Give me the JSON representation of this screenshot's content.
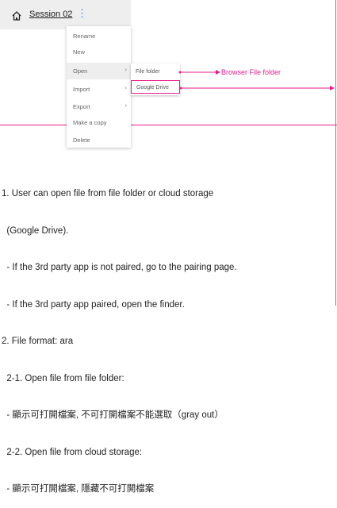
{
  "header": {
    "session_title": "Session 02"
  },
  "menu": {
    "items": [
      {
        "label": "Rename",
        "has_submenu": false,
        "active": false
      },
      {
        "label": "New",
        "has_submenu": false,
        "active": false
      },
      {
        "label": "Open",
        "has_submenu": true,
        "active": true
      },
      {
        "label": "Import",
        "has_submenu": true,
        "active": false
      },
      {
        "label": "Export",
        "has_submenu": true,
        "active": false
      },
      {
        "label": "Make a copy",
        "has_submenu": false,
        "active": false
      },
      {
        "label": "Delete",
        "has_submenu": false,
        "active": false
      }
    ],
    "submenu_arrow": "›"
  },
  "submenu": {
    "items": [
      {
        "label": "File folder"
      },
      {
        "label": "Google Drive"
      }
    ]
  },
  "annotation": {
    "label": "Browser File folder",
    "color": "#e91e8c"
  },
  "notes": {
    "lines": [
      "1. User can open file from file folder or cloud storage",
      "  (Google Drive).",
      "  - If the 3rd party app is not paired, go to the pairing page.",
      "  - If the 3rd party app paired, open the finder.",
      "2. File format: ara",
      "  2-1. Open file from file folder:",
      "  - 顯示可打開檔案, 不可打開檔案不能選取（gray out）",
      "  2-2. Open file from cloud storage:",
      "  - 顯示可打開檔案, 隱藏不可打開檔案"
    ]
  },
  "colors": {
    "accent_pink": "#e91e8c",
    "kebab_blue": "#2a7ae4",
    "guide_teal": "#20b3a8"
  }
}
